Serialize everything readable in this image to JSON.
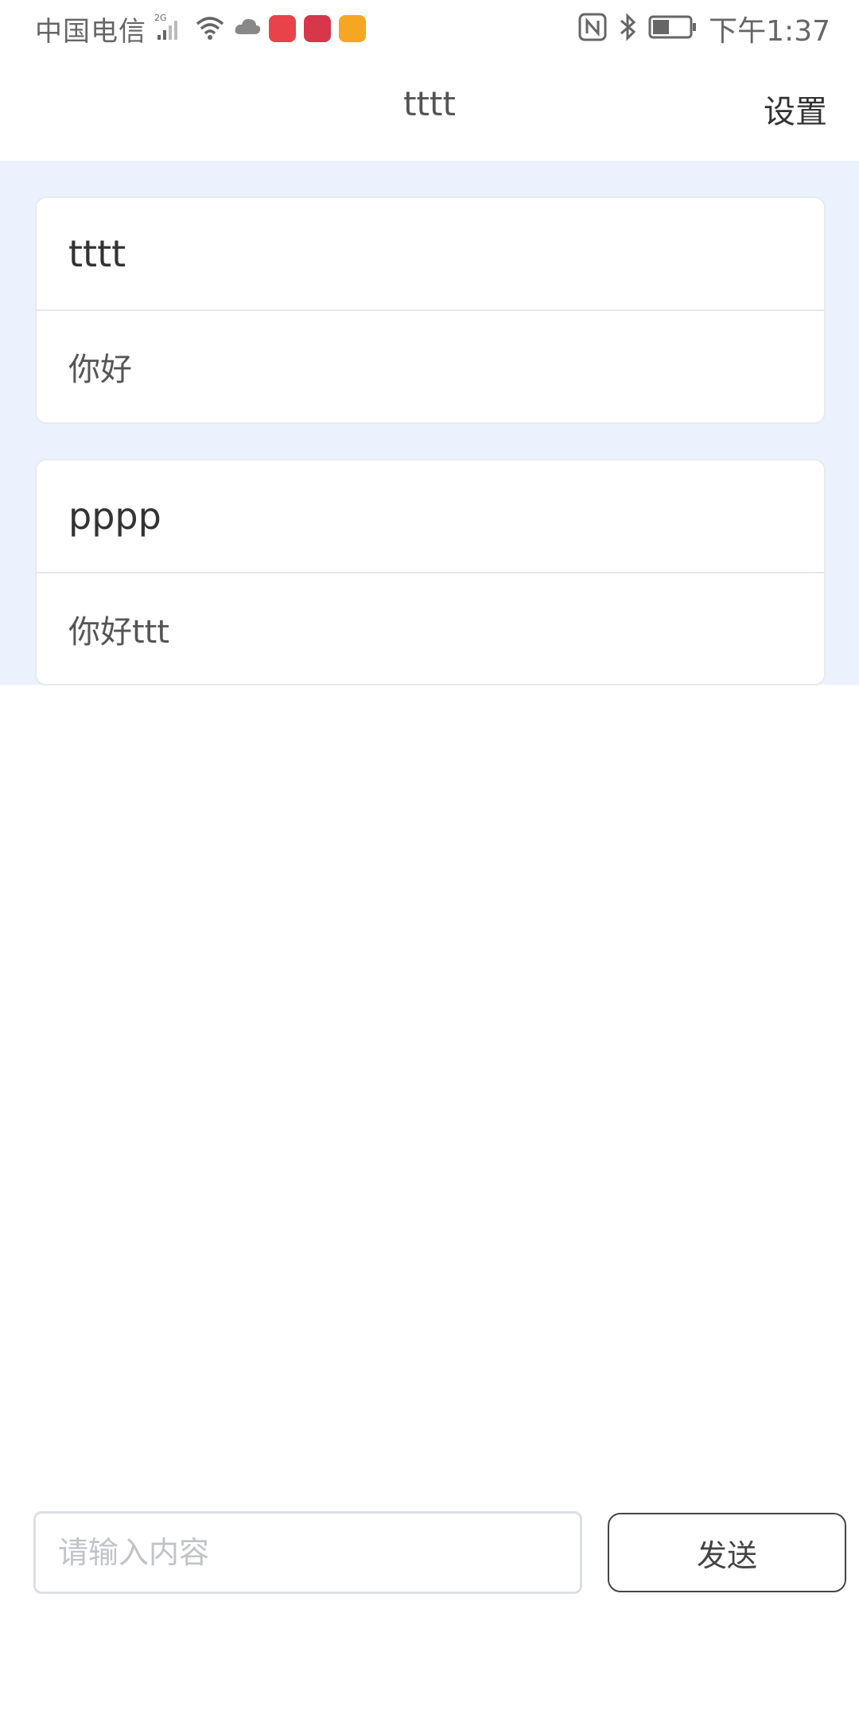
{
  "status_bar": {
    "carrier": "中国电信",
    "network_type": "2G",
    "time": "下午1:37",
    "icons": [
      "signal-icon",
      "wifi-icon",
      "cloud-icon",
      "huawei-appgallery-icon",
      "book-icon",
      "folder-icon",
      "nfc-icon",
      "bluetooth-icon",
      "battery-icon"
    ],
    "battery_level": 0.45
  },
  "navbar": {
    "title": "tttt",
    "settings_label": "设置"
  },
  "messages": [
    {
      "sender": "tttt",
      "content": "你好"
    },
    {
      "sender": "pppp",
      "content": "你好ttt"
    }
  ],
  "composer": {
    "placeholder": "请输入内容",
    "value": "",
    "send_label": "发送"
  },
  "colors": {
    "message_area_bg": "#ebf2fd",
    "card_bg": "#ffffff",
    "border": "#e7eaee"
  }
}
